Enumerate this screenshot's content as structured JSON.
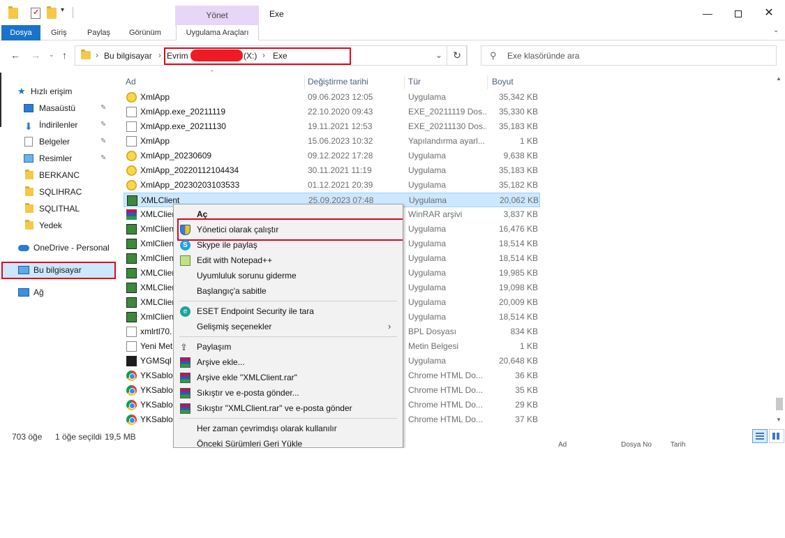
{
  "window": {
    "title": "Exe",
    "context_tab_header": "Yönet",
    "minimize": "—",
    "close": "✕"
  },
  "ribbon": {
    "tabs": [
      "Dosya",
      "Giriş",
      "Paylaş",
      "Görünüm",
      "Uygulama Araçları"
    ],
    "expand": "⌄"
  },
  "address": {
    "back": "←",
    "forward": "→",
    "recent": "⌄",
    "up": "↑",
    "crumbs": [
      "Bu bilgisayar",
      "Evrim",
      "(X:)",
      "Exe"
    ],
    "sep": "›",
    "dropdown": "⌄",
    "refresh": "↻",
    "search_placeholder": "Exe klasöründe ara"
  },
  "nav": {
    "quick_access": "Hızlı erişim",
    "items": [
      {
        "label": "Masaüstü",
        "pinned": true
      },
      {
        "label": "İndirilenler",
        "pinned": true
      },
      {
        "label": "Belgeler",
        "pinned": true
      },
      {
        "label": "Resimler",
        "pinned": true
      },
      {
        "label": "BERKANC"
      },
      {
        "label": "SQLIHRAC"
      },
      {
        "label": "SQLITHAL"
      },
      {
        "label": "Yedek"
      }
    ],
    "onedrive": "OneDrive - Personal",
    "this_pc": "Bu bilgisayar",
    "network": "Ağ",
    "pin": "📌"
  },
  "columns": {
    "name": "Ad",
    "date": "Değiştirme tarihi",
    "type": "Tür",
    "size": "Boyut"
  },
  "files": [
    {
      "name": "XmlApp",
      "date": "09.06.2023 12:05",
      "type": "Uygulama",
      "size": "35,342 KB",
      "icon": "app"
    },
    {
      "name": "XmlApp.exe_20211119",
      "date": "22.10.2020 09:43",
      "type": "EXE_20211119 Dos...",
      "size": "35,330 KB",
      "icon": "file"
    },
    {
      "name": "XmlApp.exe_20211130",
      "date": "19.11.2021 12:53",
      "type": "EXE_20211130 Dos...",
      "size": "35,183 KB",
      "icon": "file"
    },
    {
      "name": "XmlApp",
      "date": "15.06.2023 10:32",
      "type": "Yapılandırma ayarl...",
      "size": "1 KB",
      "icon": "file"
    },
    {
      "name": "XmlApp_20230609",
      "date": "09.12.2022 17:28",
      "type": "Uygulama",
      "size": "9,638 KB",
      "icon": "app"
    },
    {
      "name": "XmlApp_20220112104434",
      "date": "30.11.2021 11:19",
      "type": "Uygulama",
      "size": "35,183 KB",
      "icon": "app"
    },
    {
      "name": "XmlApp_20230203103533",
      "date": "01.12.2021 20:39",
      "type": "Uygulama",
      "size": "35,182 KB",
      "icon": "app"
    },
    {
      "name": "XMLClient",
      "date": "25.09.2023 07:48",
      "type": "Uygulama",
      "size": "20,062 KB",
      "icon": "xml",
      "selected": true
    },
    {
      "name": "XMLClien",
      "date": "",
      "type": "WinRAR arşivi",
      "size": "3,837 KB",
      "icon": "rar"
    },
    {
      "name": "XmlClien",
      "date": "",
      "type": "Uygulama",
      "size": "16,476 KB",
      "icon": "xml"
    },
    {
      "name": "XmlClien",
      "date": "",
      "type": "Uygulama",
      "size": "18,514 KB",
      "icon": "xml"
    },
    {
      "name": "XmlClien",
      "date": "",
      "type": "Uygulama",
      "size": "18,514 KB",
      "icon": "xml"
    },
    {
      "name": "XMLClien",
      "date": "",
      "type": "Uygulama",
      "size": "19,985 KB",
      "icon": "xml"
    },
    {
      "name": "XMLClien",
      "date": "",
      "type": "Uygulama",
      "size": "19,098 KB",
      "icon": "xml"
    },
    {
      "name": "XMLClien",
      "date": "",
      "type": "Uygulama",
      "size": "20,009 KB",
      "icon": "xml"
    },
    {
      "name": "XmlClien",
      "date": "",
      "type": "Uygulama",
      "size": "18,514 KB",
      "icon": "xml"
    },
    {
      "name": "xmlrtl70.",
      "date": "",
      "type": "BPL Dosyası",
      "size": "834 KB",
      "icon": "file"
    },
    {
      "name": "Yeni Met",
      "date": "",
      "type": "Metin Belgesi",
      "size": "1 KB",
      "icon": "file"
    },
    {
      "name": "YGMSql",
      "date": "",
      "type": "Uygulama",
      "size": "20,648 KB",
      "icon": "ygm"
    },
    {
      "name": "YKSablor",
      "date": "",
      "type": "Chrome HTML Do...",
      "size": "36 KB",
      "icon": "chrome"
    },
    {
      "name": "YKSablor",
      "date": "",
      "type": "Chrome HTML Do...",
      "size": "35 KB",
      "icon": "chrome"
    },
    {
      "name": "YKSablor",
      "date": "",
      "type": "Chrome HTML Do...",
      "size": "29 KB",
      "icon": "chrome"
    },
    {
      "name": "YKSablor",
      "date": "",
      "type": "Chrome HTML Do...",
      "size": "37 KB",
      "icon": "chrome"
    }
  ],
  "status": {
    "count": "703 öğe",
    "selected": "1 öğe seçildi",
    "size": "19,5 MB"
  },
  "bottom_ghost": {
    "a": "Ad",
    "b": "Dosya No",
    "c": "Tarih"
  },
  "context_menu": {
    "open": "Aç",
    "run_as_admin": "Yönetici olarak çalıştır",
    "skype": "Skype ile paylaş",
    "notepad": "Edit with Notepad++",
    "troubleshoot": "Uyumluluk sorunu giderme",
    "pin_start": "Başlangıç'a sabitle",
    "eset": "ESET Endpoint Security ile tara",
    "advanced": "Gelişmiş seçenekler",
    "advanced_arrow": "›",
    "share": "Paylaşım",
    "add_archive": "Arşive ekle...",
    "add_rar": "Arşive ekle \"XMLClient.rar\"",
    "compress_email": "Sıkıştır ve e-posta gönder...",
    "compress_rar_email": "Sıkıştır \"XMLClient.rar\" ve e-posta gönder",
    "offline": "Her zaman çevrimdışı olarak kullanılır",
    "restore": "Önceki Sürümleri Geri Yükle"
  }
}
